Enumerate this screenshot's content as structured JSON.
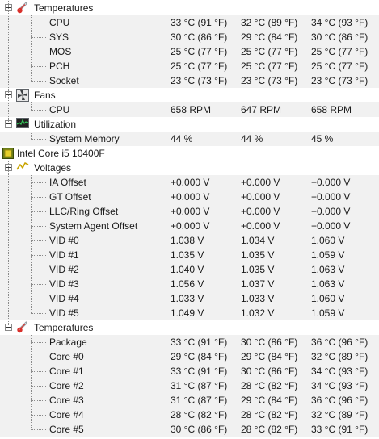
{
  "sections": [
    {
      "name": "Temperatures",
      "icon": "thermometer-icon",
      "rows": [
        {
          "label": "CPU",
          "v": [
            "33 °C  (91 °F)",
            "32 °C  (89 °F)",
            "34 °C  (93 °F)"
          ]
        },
        {
          "label": "SYS",
          "v": [
            "30 °C  (86 °F)",
            "29 °C  (84 °F)",
            "30 °C  (86 °F)"
          ]
        },
        {
          "label": "MOS",
          "v": [
            "25 °C  (77 °F)",
            "25 °C  (77 °F)",
            "25 °C  (77 °F)"
          ]
        },
        {
          "label": "PCH",
          "v": [
            "25 °C  (77 °F)",
            "25 °C  (77 °F)",
            "25 °C  (77 °F)"
          ]
        },
        {
          "label": "Socket",
          "v": [
            "23 °C  (73 °F)",
            "23 °C  (73 °F)",
            "23 °C  (73 °F)"
          ]
        }
      ]
    },
    {
      "name": "Fans",
      "icon": "fan-icon",
      "rows": [
        {
          "label": "CPU",
          "v": [
            "658 RPM",
            "647 RPM",
            "658 RPM"
          ]
        }
      ]
    },
    {
      "name": "Utilization",
      "icon": "utilization-icon",
      "rows": [
        {
          "label": "System Memory",
          "v": [
            "44 %",
            "44 %",
            "45 %"
          ]
        }
      ]
    }
  ],
  "device": {
    "name": "Intel Core i5 10400F",
    "icon": "cpu-chip-icon",
    "sections": [
      {
        "name": "Voltages",
        "icon": "voltage-icon",
        "rows": [
          {
            "label": "IA Offset",
            "v": [
              "+0.000 V",
              "+0.000 V",
              "+0.000 V"
            ]
          },
          {
            "label": "GT Offset",
            "v": [
              "+0.000 V",
              "+0.000 V",
              "+0.000 V"
            ]
          },
          {
            "label": "LLC/Ring Offset",
            "v": [
              "+0.000 V",
              "+0.000 V",
              "+0.000 V"
            ]
          },
          {
            "label": "System Agent Offset",
            "v": [
              "+0.000 V",
              "+0.000 V",
              "+0.000 V"
            ]
          },
          {
            "label": "VID #0",
            "v": [
              "1.038 V",
              "1.034 V",
              "1.060 V"
            ]
          },
          {
            "label": "VID #1",
            "v": [
              "1.035 V",
              "1.035 V",
              "1.059 V"
            ]
          },
          {
            "label": "VID #2",
            "v": [
              "1.040 V",
              "1.035 V",
              "1.063 V"
            ]
          },
          {
            "label": "VID #3",
            "v": [
              "1.056 V",
              "1.037 V",
              "1.063 V"
            ]
          },
          {
            "label": "VID #4",
            "v": [
              "1.033 V",
              "1.033 V",
              "1.060 V"
            ]
          },
          {
            "label": "VID #5",
            "v": [
              "1.049 V",
              "1.032 V",
              "1.059 V"
            ]
          }
        ]
      },
      {
        "name": "Temperatures",
        "icon": "thermometer-icon",
        "rows": [
          {
            "label": "Package",
            "v": [
              "33 °C  (91 °F)",
              "30 °C  (86 °F)",
              "36 °C  (96 °F)"
            ]
          },
          {
            "label": "Core #0",
            "v": [
              "29 °C  (84 °F)",
              "29 °C  (84 °F)",
              "32 °C  (89 °F)"
            ]
          },
          {
            "label": "Core #1",
            "v": [
              "33 °C  (91 °F)",
              "30 °C  (86 °F)",
              "34 °C  (93 °F)"
            ]
          },
          {
            "label": "Core #2",
            "v": [
              "31 °C  (87 °F)",
              "28 °C  (82 °F)",
              "34 °C  (93 °F)"
            ]
          },
          {
            "label": "Core #3",
            "v": [
              "31 °C  (87 °F)",
              "29 °C  (84 °F)",
              "36 °C  (96 °F)"
            ]
          },
          {
            "label": "Core #4",
            "v": [
              "28 °C  (82 °F)",
              "28 °C  (82 °F)",
              "32 °C  (89 °F)"
            ]
          },
          {
            "label": "Core #5",
            "v": [
              "30 °C  (86 °F)",
              "28 °C  (82 °F)",
              "33 °C  (91 °F)"
            ]
          }
        ]
      }
    ]
  }
}
